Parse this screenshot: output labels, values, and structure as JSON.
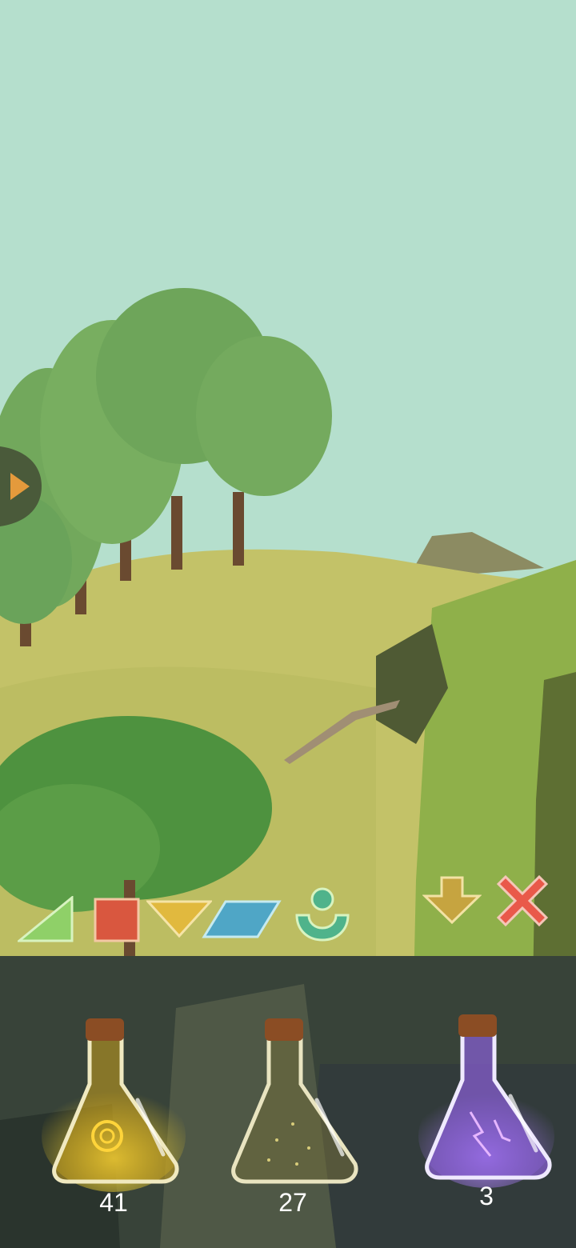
{
  "colors": {
    "sky": "#b5dfcd",
    "grass": "#c3c268",
    "cliff": "#8fb04a",
    "tree": "#6aa35a",
    "panel": "rgba(30,35,35,0.55)"
  },
  "toolbar": {
    "items": [
      {
        "name": "triangle-shape",
        "color": "#8fd068"
      },
      {
        "name": "square-shape",
        "color": "#d9573f"
      },
      {
        "name": "down-triangle-shape",
        "color": "#e1b93e"
      },
      {
        "name": "parallelogram-shape",
        "color": "#4fa6c6"
      },
      {
        "name": "person-shape",
        "color": "#4fb38b"
      }
    ],
    "drop_icon": "arrow-down-icon",
    "cancel_icon": "close-icon"
  },
  "potions": [
    {
      "label": "sun-potion",
      "count": "41",
      "liquid": "#e8c21a"
    },
    {
      "label": "star-potion",
      "count": "27",
      "liquid": "#6e6a3c"
    },
    {
      "label": "lightning-potion",
      "count": "3",
      "liquid": "#9a6fe6"
    }
  ]
}
